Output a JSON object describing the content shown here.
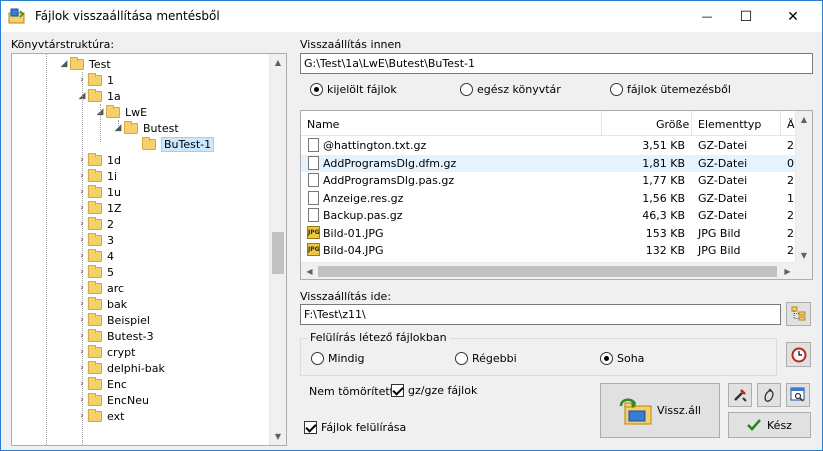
{
  "window": {
    "title": "Fájlok visszaállítása mentésből",
    "minimize_glyph": "—",
    "maximize_glyph": "☐",
    "close_glyph": "✕"
  },
  "tree": {
    "label": "Könyvtárstruktúra:",
    "items": [
      {
        "text": "Test",
        "arrow": "◢",
        "depth": 0
      },
      {
        "text": "1",
        "arrow": "›",
        "depth": 1
      },
      {
        "text": "1a",
        "arrow": "◢",
        "depth": 1
      },
      {
        "text": "LwE",
        "arrow": "◢",
        "depth": 2
      },
      {
        "text": "Butest",
        "arrow": "◢",
        "depth": 3
      },
      {
        "text": "BuTest-1",
        "arrow": "",
        "depth": 4
      },
      {
        "text": "1d",
        "arrow": "›",
        "depth": 1
      },
      {
        "text": "1i",
        "arrow": "›",
        "depth": 1
      },
      {
        "text": "1u",
        "arrow": "›",
        "depth": 1
      },
      {
        "text": "1Z",
        "arrow": "›",
        "depth": 1
      },
      {
        "text": "2",
        "arrow": "›",
        "depth": 1
      },
      {
        "text": "3",
        "arrow": "›",
        "depth": 1
      },
      {
        "text": "4",
        "arrow": "›",
        "depth": 1
      },
      {
        "text": "5",
        "arrow": "›",
        "depth": 1
      },
      {
        "text": "arc",
        "arrow": "›",
        "depth": 1
      },
      {
        "text": "bak",
        "arrow": "›",
        "depth": 1
      },
      {
        "text": "Beispiel",
        "arrow": "›",
        "depth": 1
      },
      {
        "text": "Butest-3",
        "arrow": "›",
        "depth": 1
      },
      {
        "text": "crypt",
        "arrow": "›",
        "depth": 1
      },
      {
        "text": "delphi-bak",
        "arrow": "›",
        "depth": 1
      },
      {
        "text": "Enc",
        "arrow": "›",
        "depth": 1
      },
      {
        "text": "EncNeu",
        "arrow": "›",
        "depth": 1
      },
      {
        "text": "ext",
        "arrow": "›",
        "depth": 1
      }
    ]
  },
  "source": {
    "label": "Visszaállítás innen",
    "path": "G:\\Test\\1a\\LwE\\Butest\\BuTest-1",
    "radio_selected": "kijelölt fájlok",
    "radio_all": "egész könyvtár",
    "radio_schedule": "fájlok ütemezésből"
  },
  "files": {
    "col_name": "Name",
    "col_size": "Größe",
    "col_type": "Elementtyp",
    "col_extra": "Ä",
    "rows": [
      {
        "name": "@hattington.txt.gz",
        "size": "3,51 KB",
        "type": "GZ-Datei",
        "extra": "2",
        "icon": "file"
      },
      {
        "name": "AddProgramsDlg.dfm.gz",
        "size": "1,81 KB",
        "type": "GZ-Datei",
        "extra": "0",
        "icon": "file"
      },
      {
        "name": "AddProgramsDlg.pas.gz",
        "size": "1,77 KB",
        "type": "GZ-Datei",
        "extra": "2",
        "icon": "file"
      },
      {
        "name": "Anzeige.res.gz",
        "size": "1,56 KB",
        "type": "GZ-Datei",
        "extra": "1",
        "icon": "file"
      },
      {
        "name": "Backup.pas.gz",
        "size": "46,3 KB",
        "type": "GZ-Datei",
        "extra": "2",
        "icon": "file"
      },
      {
        "name": "Bild-01.JPG",
        "size": "153 KB",
        "type": "JPG Bild",
        "extra": "2",
        "icon": "jpg"
      },
      {
        "name": "Bild-04.JPG",
        "size": "132 KB",
        "type": "JPG Bild",
        "extra": "2",
        "icon": "jpg"
      }
    ]
  },
  "dest": {
    "label": "Visszaállítás ide:",
    "path": "F:\\Test\\z11\\"
  },
  "overwrite": {
    "legend": "Felülírás létező fájlokban",
    "always": "Mindig",
    "older": "Régebbi",
    "never": "Soha"
  },
  "options": {
    "uncompressed_label": "Nem tömörített:",
    "gz_label": "gz/gze fájlok",
    "overwrite_files": "Fájlok felülírása"
  },
  "buttons": {
    "restore": "Vissz.áll",
    "done": "Kész",
    "jpg_icon_text": "JPG"
  }
}
